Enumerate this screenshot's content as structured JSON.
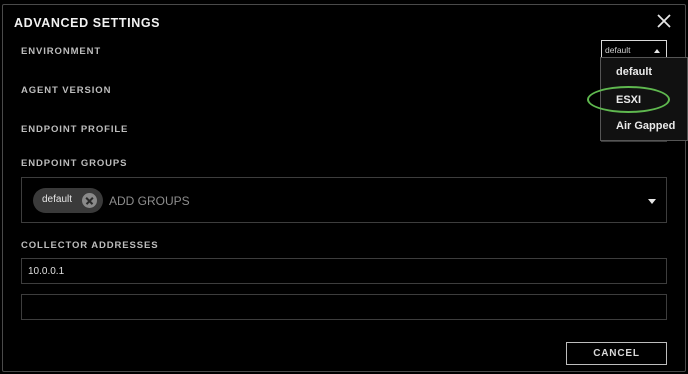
{
  "dialog": {
    "title": "ADVANCED SETTINGS",
    "close_icon": "close-icon"
  },
  "environment": {
    "label": "ENVIRONMENT",
    "selected": "default",
    "options": [
      "default",
      "ESXI",
      "Air Gapped"
    ],
    "highlighted_option": "ESXI",
    "highlight_color": "#5fb84f"
  },
  "agent_version": {
    "label": "AGENT VERSION"
  },
  "endpoint_profile": {
    "label": "ENDPOINT PROFILE"
  },
  "endpoint_groups": {
    "label": "ENDPOINT GROUPS",
    "chips": [
      "default"
    ],
    "placeholder": "ADD GROUPS"
  },
  "collector_addresses": {
    "label": "COLLECTOR ADDRESSES",
    "values": [
      "10.0.0.1",
      ""
    ]
  },
  "footer": {
    "cancel_label": "CANCEL"
  }
}
